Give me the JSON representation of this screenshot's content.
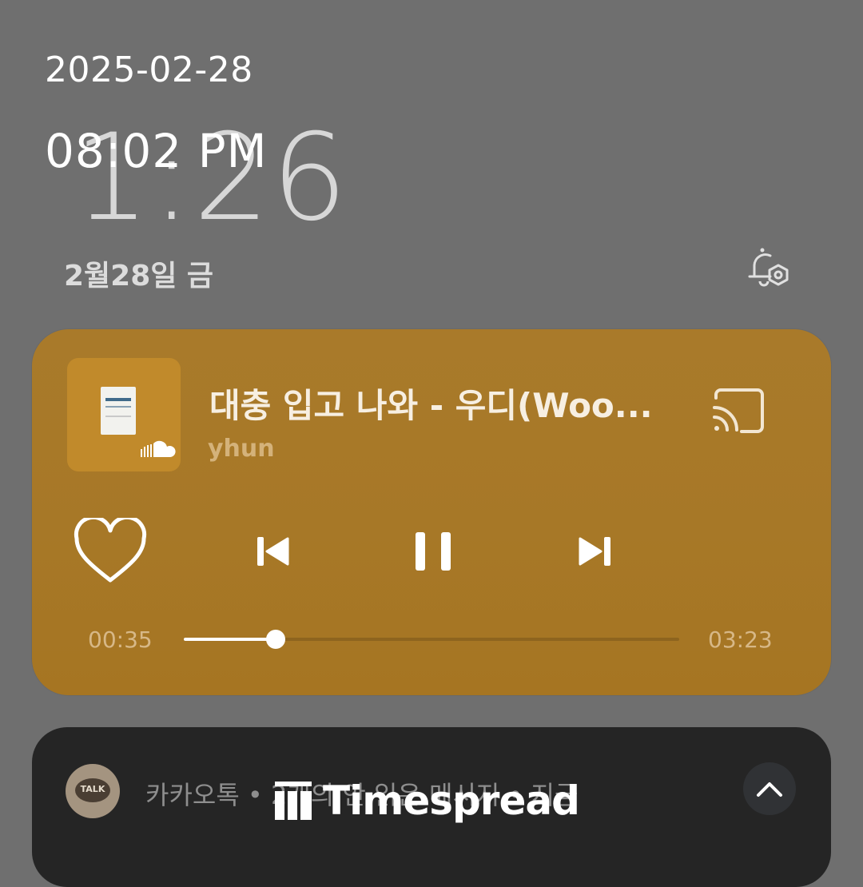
{
  "overlay": {
    "date_stamp": "2025-02-28",
    "time_stamp": "08:02 PM",
    "watermark": "Timespread"
  },
  "lockscreen": {
    "clock": "1:26",
    "date_label": "2월28일 금",
    "alarm_icon": "bell-settings-icon"
  },
  "media": {
    "track_title": "대충 입고 나와 - 우디(Woo...",
    "artist": "yhun",
    "source_icon": "soundcloud-icon",
    "cast_icon": "cast-icon",
    "controls": [
      "heart-icon",
      "previous-icon",
      "pause-icon",
      "next-icon"
    ],
    "elapsed": "00:35",
    "duration": "03:23",
    "progress": 0.185,
    "accent_color": "#a97a2a"
  },
  "notification": {
    "app_icon": "kakaotalk-icon",
    "app_icon_label": "TALK",
    "summary": "카카오톡 • 2개의 안 읽은 메시지 • 지금",
    "collapse_icon": "chevron-up-icon"
  }
}
